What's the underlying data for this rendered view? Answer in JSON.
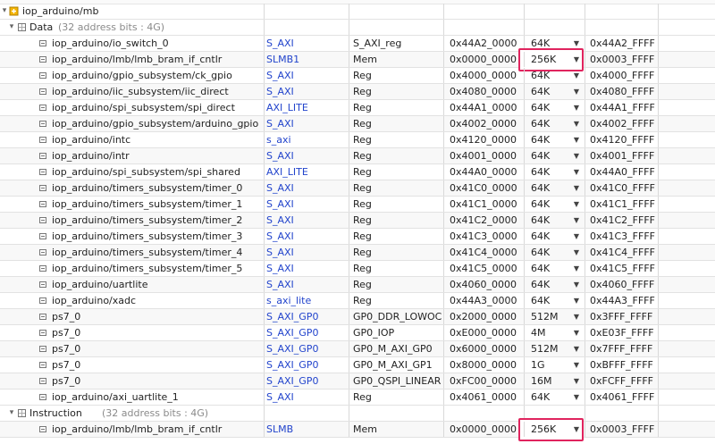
{
  "root": {
    "label": "iop_arduino/mb"
  },
  "groups": [
    {
      "name": "Data",
      "info": "(32 address bits : 4G)",
      "rows": [
        {
          "cell": "iop_arduino/io_switch_0",
          "iface": "S_AXI",
          "block": "S_AXI_reg",
          "base": "0x44A2_0000",
          "range": "64K",
          "high": "0x44A2_FFFF"
        },
        {
          "cell": "iop_arduino/lmb/lmb_bram_if_cntlr",
          "iface": "SLMB1",
          "block": "Mem",
          "base": "0x0000_0000",
          "range": "256K",
          "high": "0x0003_FFFF",
          "highlight": true
        },
        {
          "cell": "iop_arduino/gpio_subsystem/ck_gpio",
          "iface": "S_AXI",
          "block": "Reg",
          "base": "0x4000_0000",
          "range": "64K",
          "high": "0x4000_FFFF"
        },
        {
          "cell": "iop_arduino/iic_subsystem/iic_direct",
          "iface": "S_AXI",
          "block": "Reg",
          "base": "0x4080_0000",
          "range": "64K",
          "high": "0x4080_FFFF"
        },
        {
          "cell": "iop_arduino/spi_subsystem/spi_direct",
          "iface": "AXI_LITE",
          "block": "Reg",
          "base": "0x44A1_0000",
          "range": "64K",
          "high": "0x44A1_FFFF"
        },
        {
          "cell": "iop_arduino/gpio_subsystem/arduino_gpio",
          "iface": "S_AXI",
          "block": "Reg",
          "base": "0x4002_0000",
          "range": "64K",
          "high": "0x4002_FFFF"
        },
        {
          "cell": "iop_arduino/intc",
          "iface": "s_axi",
          "block": "Reg",
          "base": "0x4120_0000",
          "range": "64K",
          "high": "0x4120_FFFF"
        },
        {
          "cell": "iop_arduino/intr",
          "iface": "S_AXI",
          "block": "Reg",
          "base": "0x4001_0000",
          "range": "64K",
          "high": "0x4001_FFFF"
        },
        {
          "cell": "iop_arduino/spi_subsystem/spi_shared",
          "iface": "AXI_LITE",
          "block": "Reg",
          "base": "0x44A0_0000",
          "range": "64K",
          "high": "0x44A0_FFFF"
        },
        {
          "cell": "iop_arduino/timers_subsystem/timer_0",
          "iface": "S_AXI",
          "block": "Reg",
          "base": "0x41C0_0000",
          "range": "64K",
          "high": "0x41C0_FFFF"
        },
        {
          "cell": "iop_arduino/timers_subsystem/timer_1",
          "iface": "S_AXI",
          "block": "Reg",
          "base": "0x41C1_0000",
          "range": "64K",
          "high": "0x41C1_FFFF"
        },
        {
          "cell": "iop_arduino/timers_subsystem/timer_2",
          "iface": "S_AXI",
          "block": "Reg",
          "base": "0x41C2_0000",
          "range": "64K",
          "high": "0x41C2_FFFF"
        },
        {
          "cell": "iop_arduino/timers_subsystem/timer_3",
          "iface": "S_AXI",
          "block": "Reg",
          "base": "0x41C3_0000",
          "range": "64K",
          "high": "0x41C3_FFFF"
        },
        {
          "cell": "iop_arduino/timers_subsystem/timer_4",
          "iface": "S_AXI",
          "block": "Reg",
          "base": "0x41C4_0000",
          "range": "64K",
          "high": "0x41C4_FFFF"
        },
        {
          "cell": "iop_arduino/timers_subsystem/timer_5",
          "iface": "S_AXI",
          "block": "Reg",
          "base": "0x41C5_0000",
          "range": "64K",
          "high": "0x41C5_FFFF"
        },
        {
          "cell": "iop_arduino/uartlite",
          "iface": "S_AXI",
          "block": "Reg",
          "base": "0x4060_0000",
          "range": "64K",
          "high": "0x4060_FFFF"
        },
        {
          "cell": "iop_arduino/xadc",
          "iface": "s_axi_lite",
          "block": "Reg",
          "base": "0x44A3_0000",
          "range": "64K",
          "high": "0x44A3_FFFF"
        },
        {
          "cell": "ps7_0",
          "iface": "S_AXI_GP0",
          "block": "GP0_DDR_LOWOCM",
          "base": "0x2000_0000",
          "range": "512M",
          "high": "0x3FFF_FFFF"
        },
        {
          "cell": "ps7_0",
          "iface": "S_AXI_GP0",
          "block": "GP0_IOP",
          "base": "0xE000_0000",
          "range": "4M",
          "high": "0xE03F_FFFF"
        },
        {
          "cell": "ps7_0",
          "iface": "S_AXI_GP0",
          "block": "GP0_M_AXI_GP0",
          "base": "0x6000_0000",
          "range": "512M",
          "high": "0x7FFF_FFFF"
        },
        {
          "cell": "ps7_0",
          "iface": "S_AXI_GP0",
          "block": "GP0_M_AXI_GP1",
          "base": "0x8000_0000",
          "range": "1G",
          "high": "0xBFFF_FFFF"
        },
        {
          "cell": "ps7_0",
          "iface": "S_AXI_GP0",
          "block": "GP0_QSPI_LINEAR",
          "base": "0xFC00_0000",
          "range": "16M",
          "high": "0xFCFF_FFFF"
        },
        {
          "cell": "iop_arduino/axi_uartlite_1",
          "iface": "S_AXI",
          "block": "Reg",
          "base": "0x4061_0000",
          "range": "64K",
          "high": "0x4061_FFFF"
        }
      ]
    },
    {
      "name": "Instruction",
      "info": "(32 address bits : 4G)",
      "rows": [
        {
          "cell": "iop_arduino/lmb/lmb_bram_if_cntlr",
          "iface": "SLMB",
          "block": "Mem",
          "base": "0x0000_0000",
          "range": "256K",
          "high": "0x0003_FFFF",
          "highlight": true
        }
      ]
    }
  ],
  "icons": {
    "expand": "chevron-down-icon",
    "root": "microblaze-icon",
    "address_space": "address-space-icon",
    "segment": "address-segment-icon",
    "dropdown": "dropdown-arrow-icon"
  },
  "colors": {
    "link": "#2244cc",
    "highlight": "#e0245e"
  }
}
